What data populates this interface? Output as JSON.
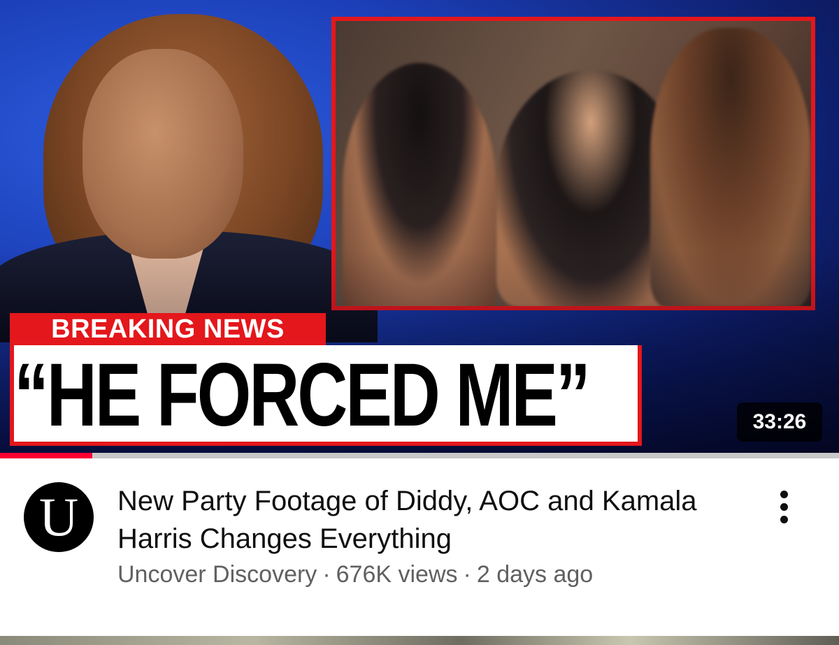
{
  "video": {
    "thumbnail": {
      "label_breaking": "BREAKING NEWS",
      "headline": "“HE FORCED ME”",
      "duration": "33:26",
      "watched_fraction": 0.11,
      "accent_color": "#e3171c"
    },
    "title": "New Party Footage of Diddy, AOC and Kamala Harris Changes Everything",
    "channel": {
      "name": "Uncover Discovery",
      "avatar_letter": "U"
    },
    "views": "676K views",
    "age": "2 days ago",
    "separator": "·",
    "menu_icon": "more-vert-icon"
  }
}
